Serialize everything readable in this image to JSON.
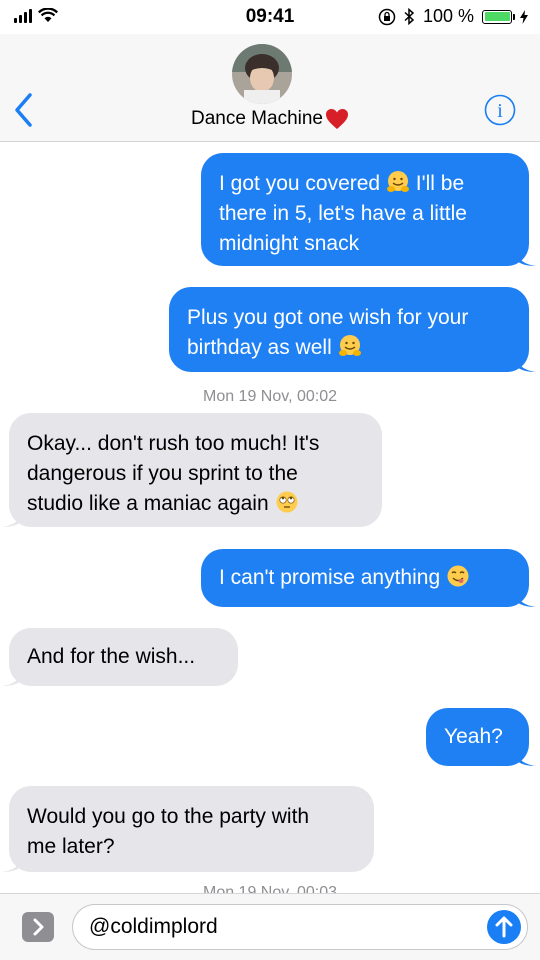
{
  "status_bar": {
    "time": "09:41",
    "battery_percent": "100 %",
    "battery_level": 1.0
  },
  "header": {
    "contact_name": "Dance Machine",
    "icons": [
      "back-chevron-icon",
      "avatar",
      "heart-emoji",
      "info-icon"
    ]
  },
  "messages": [
    {
      "side": "sent",
      "text_lines": [
        "I got you covered",
        "I'll be",
        "there in 5, let's have a little",
        "midnight snack"
      ]
    },
    {
      "side": "sent",
      "text_lines": [
        "Plus you got one wish for your",
        "birthday as well"
      ]
    },
    {
      "timestamp": "Mon 19 Nov, 00:02"
    },
    {
      "side": "received",
      "text_lines": [
        "Okay... don't rush too much! It's",
        "dangerous if you sprint to the",
        "studio like a maniac again"
      ]
    },
    {
      "side": "sent",
      "text_lines": [
        "I can't promise anything"
      ]
    },
    {
      "side": "received",
      "text_lines": [
        "And for the wish..."
      ]
    },
    {
      "side": "sent",
      "text_lines": [
        "Yeah?"
      ]
    },
    {
      "side": "received",
      "text_lines": [
        "Would you go to the party with",
        "me later?"
      ]
    }
  ],
  "partial_timestamp": "Mon 19 Nov, 00:03",
  "input": {
    "value": "@coldimplord"
  },
  "colors": {
    "sent_bubble": "#1f80f4",
    "received_bubble": "#e5e5ea",
    "accent": "#1a7ef5"
  }
}
